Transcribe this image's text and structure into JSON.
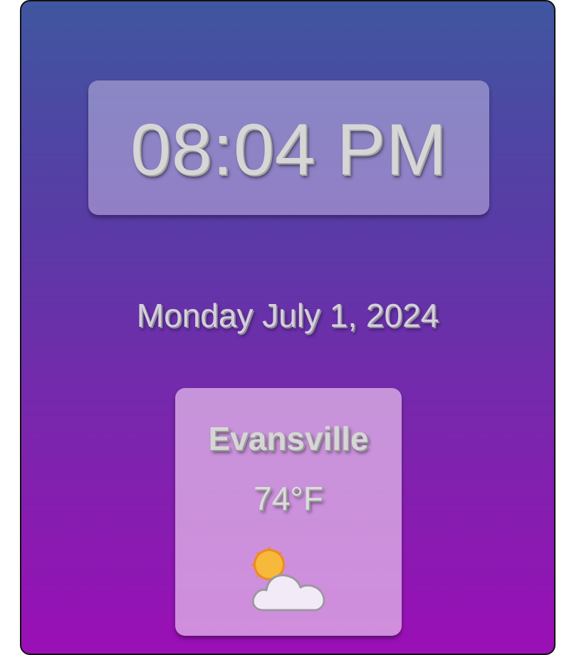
{
  "clock": {
    "time": "08:04 PM"
  },
  "date": {
    "text": "Monday July 1, 2024"
  },
  "weather": {
    "city": "Evansville",
    "temperature": "74°F",
    "condition_icon": "partly-cloudy-icon"
  },
  "colors": {
    "background_top": "#3f56a0",
    "background_bottom": "#9a0fb6",
    "sun": "#f6b93b",
    "sun_rays": "#f08a1e",
    "cloud": "#f3eaf7"
  }
}
